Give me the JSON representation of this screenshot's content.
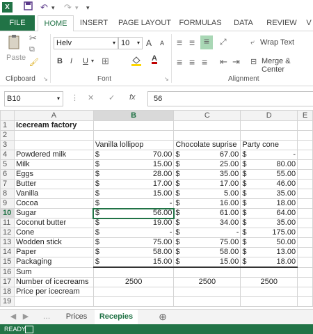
{
  "qat": {
    "excel_icon": "X",
    "save_icon": "save-icon",
    "undo_icon": "undo-icon",
    "redo_icon": "redo-icon"
  },
  "tabs": [
    "FILE",
    "HOME",
    "INSERT",
    "PAGE LAYOUT",
    "FORMULAS",
    "DATA",
    "REVIEW",
    "V"
  ],
  "ribbon": {
    "paste_label": "Paste",
    "font_name": "Helv",
    "font_size": "10",
    "grow_font": "A",
    "shrink_font": "A",
    "bold": "B",
    "italic": "I",
    "underline": "U",
    "wrap_text": "Wrap Text",
    "merge_center": "Merge & Center",
    "group_clipboard": "Clipboard",
    "group_font": "Font",
    "group_alignment": "Alignment"
  },
  "formula_bar": {
    "name_box": "B10",
    "fx": "fx",
    "value": "56"
  },
  "columns": [
    "A",
    "B",
    "C",
    "D",
    "E"
  ],
  "rows": [
    {
      "n": "1",
      "a": "Icecream factory",
      "b": "",
      "c": "",
      "d": ""
    },
    {
      "n": "2",
      "a": "",
      "b": "",
      "c": "",
      "d": ""
    },
    {
      "n": "3",
      "a": "",
      "b": "Vanilla lollipop",
      "c": "Chocolate suprise",
      "d": "Party cone"
    },
    {
      "n": "4",
      "a": "Powdered milk",
      "b": "70.00",
      "c": "67.00",
      "d": "-"
    },
    {
      "n": "5",
      "a": "Milk",
      "b": "15.00",
      "c": "25.00",
      "d": "80.00"
    },
    {
      "n": "6",
      "a": "Eggs",
      "b": "28.00",
      "c": "35.00",
      "d": "55.00"
    },
    {
      "n": "7",
      "a": "Butter",
      "b": "17.00",
      "c": "17.00",
      "d": "46.00"
    },
    {
      "n": "8",
      "a": "Vanilla",
      "b": "15.00",
      "c": "5.00",
      "d": "35.00"
    },
    {
      "n": "9",
      "a": "Cocoa",
      "b": "-",
      "c": "16.00",
      "d": "18.00"
    },
    {
      "n": "10",
      "a": "Sugar",
      "b": "56.00",
      "c": "61.00",
      "d": "64.00"
    },
    {
      "n": "11",
      "a": "Coconut butter",
      "b": "19.00",
      "c": "34.00",
      "d": "35.00"
    },
    {
      "n": "12",
      "a": "Cone",
      "b": "-",
      "c": "-",
      "d": "175.00"
    },
    {
      "n": "13",
      "a": "Wodden stick",
      "b": "75.00",
      "c": "75.00",
      "d": "50.00"
    },
    {
      "n": "14",
      "a": "Paper",
      "b": "58.00",
      "c": "58.00",
      "d": "13.00"
    },
    {
      "n": "15",
      "a": "Packaging",
      "b": "15.00",
      "c": "15.00",
      "d": "18.00"
    },
    {
      "n": "16",
      "a": "Sum",
      "b": "",
      "c": "",
      "d": ""
    },
    {
      "n": "17",
      "a": "Number of icecreams",
      "b": "2500",
      "c": "2500",
      "d": "2500"
    },
    {
      "n": "18",
      "a": "Price per icecream",
      "b": "",
      "c": "",
      "d": ""
    },
    {
      "n": "19",
      "a": "",
      "b": "",
      "c": "",
      "d": ""
    }
  ],
  "currency_symbol": "$",
  "sheet_tabs": [
    "Prices",
    "Recepies"
  ],
  "active_sheet": "Recepies",
  "status": "READY",
  "colors": {
    "accent": "#217346"
  }
}
